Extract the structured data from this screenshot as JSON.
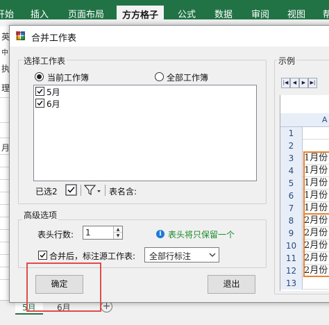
{
  "ribbon": {
    "tabs": [
      "开始",
      "插入",
      "页面布局",
      "方方格子",
      "公式",
      "数据",
      "审阅",
      "视图",
      "帮"
    ],
    "active_tab": "方方格子",
    "color": "#217346"
  },
  "background": {
    "left_texts": [
      "英",
      "中",
      "执",
      "理"
    ],
    "row_label": "月"
  },
  "sheets": {
    "tabs": [
      "5月",
      "6月"
    ],
    "active": "5月",
    "add_symbol": "+"
  },
  "dialog": {
    "title": "合并工作表",
    "select_sheets": {
      "group_title": "选择工作表",
      "options": [
        "当前工作簿",
        "全部工作簿"
      ],
      "selected_option": "当前工作簿",
      "sheets": [
        {
          "name": "5月",
          "checked": true
        },
        {
          "name": "6月",
          "checked": true
        }
      ],
      "selected_count_label": "已选2",
      "table_name_label": "表名含:",
      "table_name_value": ""
    },
    "advanced": {
      "group_title": "高级选项",
      "header_rows_label": "表头行数:",
      "header_rows_value": "1",
      "hint_text": "表头将只保留一个",
      "mark_source_label": "合并后，标注源工作表:",
      "mark_source_checked": true,
      "mark_source_value": "全部行标注"
    },
    "buttons": {
      "ok": "确定",
      "exit": "退出"
    },
    "preview": {
      "group_title": "示例",
      "column_header": "A",
      "rows": [
        {
          "num": "1",
          "text": ""
        },
        {
          "num": "2",
          "text": ""
        },
        {
          "num": "3",
          "text": "1月份"
        },
        {
          "num": "4",
          "text": "1月份"
        },
        {
          "num": "5",
          "text": "1月份"
        },
        {
          "num": "6",
          "text": "1月份"
        },
        {
          "num": "7",
          "text": "1月份"
        },
        {
          "num": "8",
          "text": "2月份"
        },
        {
          "num": "9",
          "text": "2月份"
        },
        {
          "num": "10",
          "text": "2月份"
        },
        {
          "num": "11",
          "text": "2月份"
        },
        {
          "num": "12",
          "text": "2月份"
        },
        {
          "num": "13",
          "text": ""
        }
      ],
      "highlight_color": "#e8822a"
    },
    "highlight_color": "#e24a4a"
  }
}
